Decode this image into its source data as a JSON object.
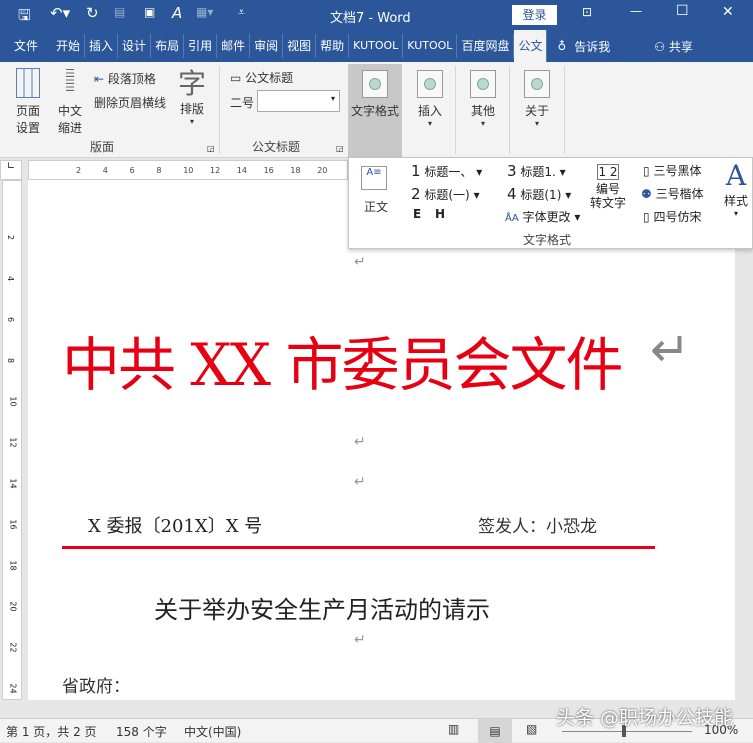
{
  "title_bar": {
    "title": "文档7  -  Word",
    "login": "登录"
  },
  "tabs": [
    "文件",
    "开始",
    "插入",
    "设计",
    "布局",
    "引用",
    "邮件",
    "审阅",
    "视图",
    "帮助",
    "KUTOOL",
    "KUTOOL",
    "百度网盘",
    "公文"
  ],
  "tell_me": "告诉我",
  "share": "共享",
  "ribbon": {
    "page_setup": "页面\n设置",
    "cn_indent": "中文\n缩进",
    "para_top": "段落顶格",
    "del_header_line": "删除页眉横线",
    "layout": "排版",
    "layout_glyph": "字",
    "group1": "版面",
    "doc_title": "公文标题",
    "size_label": "二号",
    "size_value": "",
    "group2": "公文标题",
    "text_format": "文字格式",
    "text_format2": "式",
    "insert": "插入",
    "other": "其他",
    "about": "关于"
  },
  "panel": {
    "body": "正文",
    "h1": "标题一、",
    "h2": "标题(一)",
    "h3": "标题1.",
    "h4": "标题(1)",
    "n1": "1",
    "n2": "2",
    "n3": "3",
    "n4": "4",
    "e": "E",
    "h": "H",
    "font_change": "字体更改",
    "num_to_text": "编号\n转文字",
    "s1": "三号黑体",
    "s2": "三号楷体",
    "s3": "四号仿宋",
    "styles": "样式",
    "group": "文字格式"
  },
  "ruler_ticks": [
    "2",
    "4",
    "6",
    "8",
    "10",
    "12",
    "14",
    "16",
    "18",
    "20"
  ],
  "vruler_ticks": [
    "2",
    "4",
    "6",
    "8",
    "10",
    "12",
    "14",
    "16",
    "18",
    "20",
    "22",
    "24"
  ],
  "doc": {
    "red_title": "中共 XX 市委员会文件",
    "doc_no": "X 委报〔201X〕X 号",
    "signer": "签发人：小恐龙",
    "subject": "关于举办安全生产月活动的请示",
    "addressee": "省政府：",
    "mark": "↵"
  },
  "status": {
    "page": "第 1 页，共 2 页",
    "words": "158 个字",
    "lang": "中文(中国)",
    "zoom": "100%",
    "watermark": "头条 @职场办公技能"
  },
  "colors": {
    "brand": "#2b579a",
    "red": "#e60012"
  }
}
